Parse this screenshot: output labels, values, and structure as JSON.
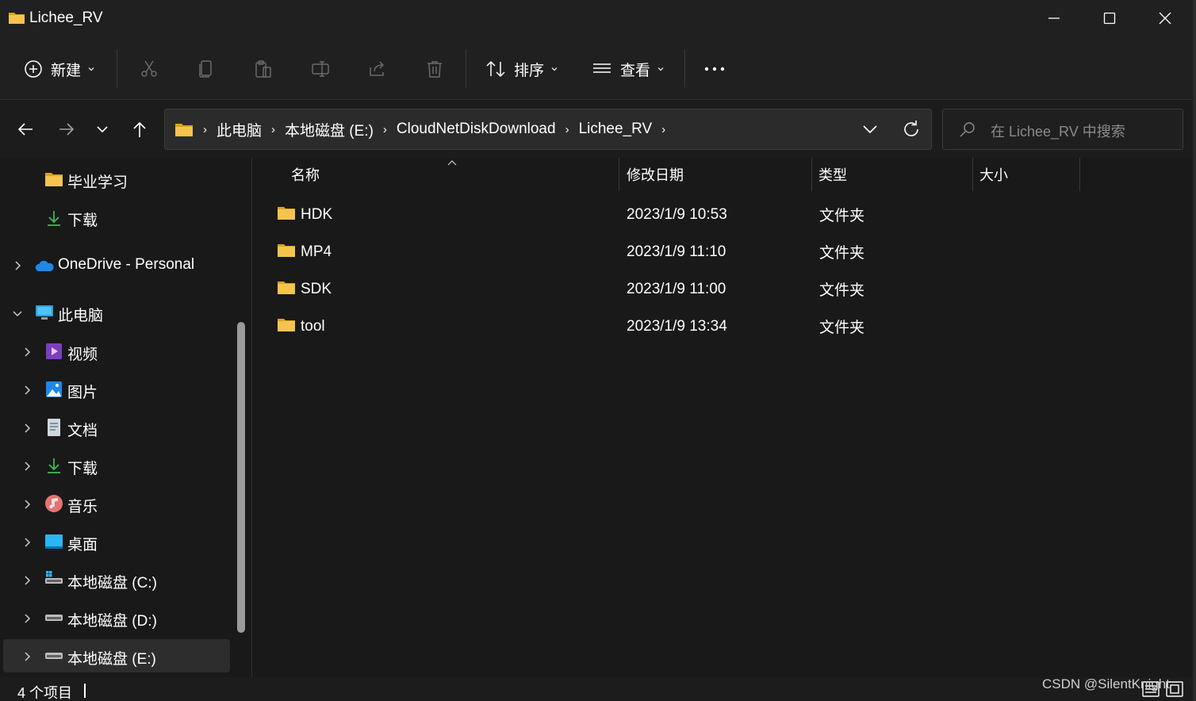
{
  "window": {
    "title": "Lichee_RV",
    "controls": {
      "minimize": "minimize",
      "maximize": "maximize",
      "close": "close"
    }
  },
  "toolbar": {
    "new_label": "新建",
    "sort_label": "排序",
    "view_label": "查看",
    "buttons": [
      "cut-icon",
      "copy-icon",
      "paste-icon",
      "rename-icon",
      "share-icon",
      "delete-icon"
    ]
  },
  "address": {
    "crumbs": [
      "此电脑",
      "本地磁盘 (E:)",
      "CloudNetDiskDownload",
      "Lichee_RV"
    ]
  },
  "search": {
    "placeholder": "在 Lichee_RV 中搜索"
  },
  "sidebar": {
    "items": [
      {
        "label": "毕业学习",
        "icon": "folder-icon"
      },
      {
        "label": "下载",
        "icon": "download-icon"
      },
      {
        "label": "OneDrive - Personal",
        "icon": "onedrive-icon"
      },
      {
        "label": "此电脑",
        "icon": "pc-icon"
      },
      {
        "label": "视频",
        "icon": "video-icon"
      },
      {
        "label": "图片",
        "icon": "picture-icon"
      },
      {
        "label": "文档",
        "icon": "document-icon"
      },
      {
        "label": "下载",
        "icon": "download-icon"
      },
      {
        "label": "音乐",
        "icon": "music-icon"
      },
      {
        "label": "桌面",
        "icon": "desktop-icon"
      },
      {
        "label": "本地磁盘 (C:)",
        "icon": "drive-c-icon"
      },
      {
        "label": "本地磁盘 (D:)",
        "icon": "drive-icon"
      },
      {
        "label": "本地磁盘 (E:)",
        "icon": "drive-icon"
      }
    ]
  },
  "columns": {
    "name": "名称",
    "modified": "修改日期",
    "type": "类型",
    "size": "大小"
  },
  "files": [
    {
      "name": "HDK",
      "modified": "2023/1/9 10:53",
      "type": "文件夹",
      "size": ""
    },
    {
      "name": "MP4",
      "modified": "2023/1/9 11:10",
      "type": "文件夹",
      "size": ""
    },
    {
      "name": "SDK",
      "modified": "2023/1/9 11:00",
      "type": "文件夹",
      "size": ""
    },
    {
      "name": "tool",
      "modified": "2023/1/9 13:34",
      "type": "文件夹",
      "size": ""
    }
  ],
  "status": {
    "count": "4 个项目"
  },
  "watermark": "CSDN @SilentKnight",
  "colors": {
    "folder": "#f4c44e",
    "background": "#191919",
    "accent": "#4cc2ff"
  }
}
